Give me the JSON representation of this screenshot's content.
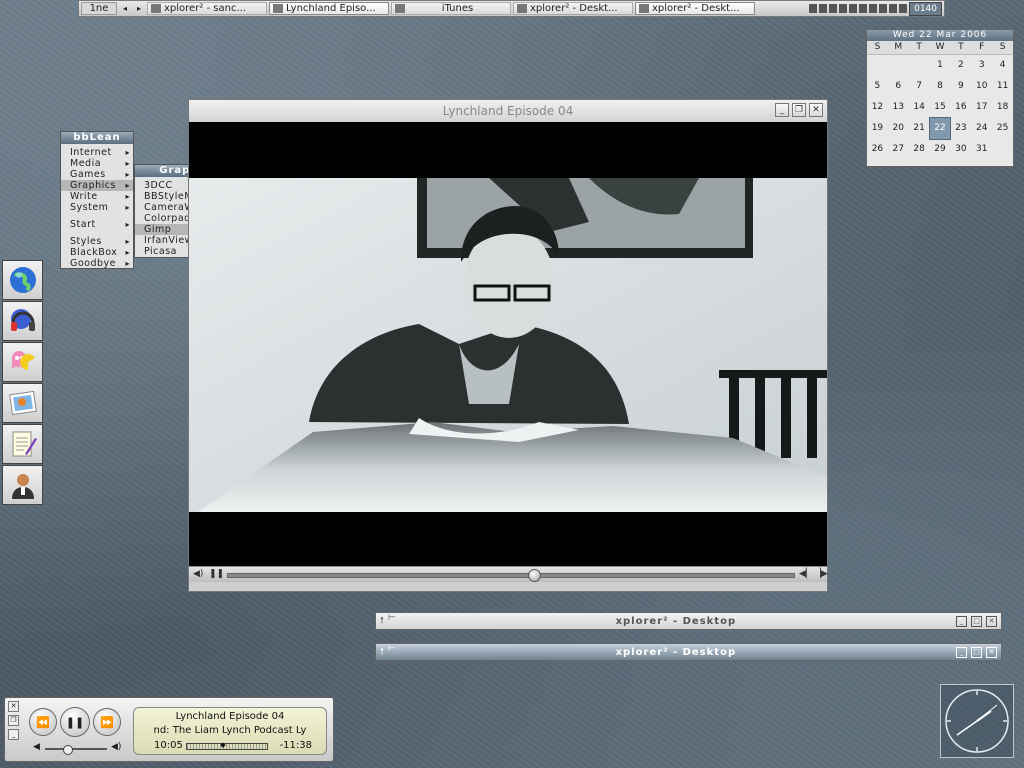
{
  "taskbar": {
    "workspace": "1ne",
    "arrows": [
      "◂",
      "▸"
    ],
    "tasks": [
      {
        "label": "xplorer² - sanc..."
      },
      {
        "label": "Lynchland Episo..."
      },
      {
        "label": "iTunes"
      },
      {
        "label": "xplorer² - Deskt..."
      },
      {
        "label": "xplorer² - Deskt..."
      }
    ],
    "tray_label": "0140"
  },
  "calendar": {
    "header": "Wed 22 Mar 2006",
    "weekdays": [
      "S",
      "M",
      "T",
      "W",
      "T",
      "F",
      "S"
    ],
    "days": [
      "",
      "",
      "",
      "1",
      "2",
      "3",
      "4",
      "5",
      "6",
      "7",
      "8",
      "9",
      "10",
      "11",
      "12",
      "13",
      "14",
      "15",
      "16",
      "17",
      "18",
      "19",
      "20",
      "21",
      "22",
      "23",
      "24",
      "25",
      "26",
      "27",
      "28",
      "29",
      "30",
      "31",
      ""
    ],
    "today": "22"
  },
  "menu": {
    "title": "bbLean",
    "items": [
      {
        "label": "Internet"
      },
      {
        "label": "Media"
      },
      {
        "label": "Games"
      },
      {
        "label": "Graphics"
      },
      {
        "label": "Write"
      },
      {
        "label": "System"
      },
      {
        "label": "Start"
      },
      {
        "label": "Styles"
      },
      {
        "label": "BlackBox"
      },
      {
        "label": "Goodbye"
      }
    ],
    "submenu": {
      "title": "Graphics",
      "items": [
        {
          "label": "3DCC"
        },
        {
          "label": "BBStyleMaker"
        },
        {
          "label": "CameraWindow"
        },
        {
          "label": "Colorpad"
        },
        {
          "label": "Gimp"
        },
        {
          "label": "IrfanView"
        },
        {
          "label": "Picasa"
        }
      ]
    }
  },
  "dock": {
    "items": [
      {
        "icon": "globe-icon"
      },
      {
        "icon": "headphones-icon"
      },
      {
        "icon": "pacman-icon"
      },
      {
        "icon": "photo-icon"
      },
      {
        "icon": "notepad-icon"
      },
      {
        "icon": "person-icon"
      }
    ]
  },
  "player_window": {
    "title": "Lynchland Episode 04",
    "seek_position": 0.54
  },
  "shaded_windows": [
    {
      "title": "xplorer² - Desktop"
    },
    {
      "title": "xplorer² - Desktop"
    }
  ],
  "mini_player": {
    "line1": "Lynchland Episode 04",
    "line2": "nd: The Liam Lynch Podcast   Ly",
    "elapsed": "10:05",
    "remaining": "-11:38",
    "progress": 0.45,
    "volume": 0.35
  },
  "colors": {
    "accent": "#6f8394",
    "desktop": "#5a6a78"
  }
}
